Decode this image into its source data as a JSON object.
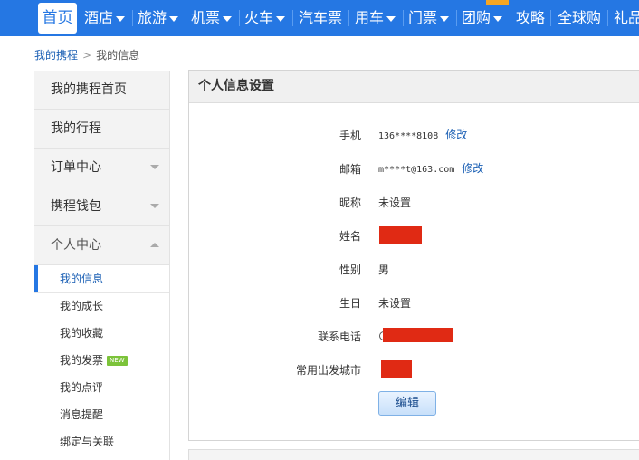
{
  "nav": {
    "home": "首页",
    "items": [
      {
        "label": "酒店",
        "dropdown": true
      },
      {
        "label": "旅游",
        "dropdown": true
      },
      {
        "label": "机票",
        "dropdown": true
      },
      {
        "label": "火车",
        "dropdown": true
      },
      {
        "label": "汽车票",
        "dropdown": false
      },
      {
        "label": "用车",
        "dropdown": true
      },
      {
        "label": "门票",
        "dropdown": true
      },
      {
        "label": "团购",
        "dropdown": true
      },
      {
        "label": "攻略",
        "dropdown": false
      },
      {
        "label": "全球购",
        "dropdown": false
      },
      {
        "label": "礼品",
        "dropdown": false
      }
    ],
    "colors": {
      "bar": "#2577e3",
      "text": "#ffffff"
    }
  },
  "breadcrumb": {
    "root": "我的携程",
    "current": "我的信息"
  },
  "sidebar": {
    "items": [
      {
        "label": "我的携程首页",
        "arrow": "none"
      },
      {
        "label": "我的行程",
        "arrow": "none"
      },
      {
        "label": "订单中心",
        "arrow": "down"
      },
      {
        "label": "携程钱包",
        "arrow": "down"
      },
      {
        "label": "个人中心",
        "arrow": "up"
      }
    ],
    "sub_items": [
      {
        "label": "我的信息",
        "active": true
      },
      {
        "label": "我的成长"
      },
      {
        "label": "我的收藏"
      },
      {
        "label": "我的发票",
        "badge": "NEW"
      },
      {
        "label": "我的点评"
      },
      {
        "label": "消息提醒"
      },
      {
        "label": "绑定与关联"
      }
    ]
  },
  "panel": {
    "title": "个人信息设置",
    "fields": {
      "mobile": {
        "label": "手机",
        "value": "136****8108",
        "action": "修改"
      },
      "email": {
        "label": "邮箱",
        "value": "m****t@163.com",
        "action": "修改"
      },
      "nickname": {
        "label": "昵称",
        "value": "未设置"
      },
      "name": {
        "label": "姓名",
        "value": ""
      },
      "gender": {
        "label": "性别",
        "value": "男"
      },
      "birthday": {
        "label": "生日",
        "value": "未设置"
      },
      "phone": {
        "label": "联系电话",
        "value": ""
      },
      "city": {
        "label": "常用出发城市",
        "value": ""
      }
    },
    "edit_button": "编辑",
    "redaction_color": "#e02a14"
  }
}
